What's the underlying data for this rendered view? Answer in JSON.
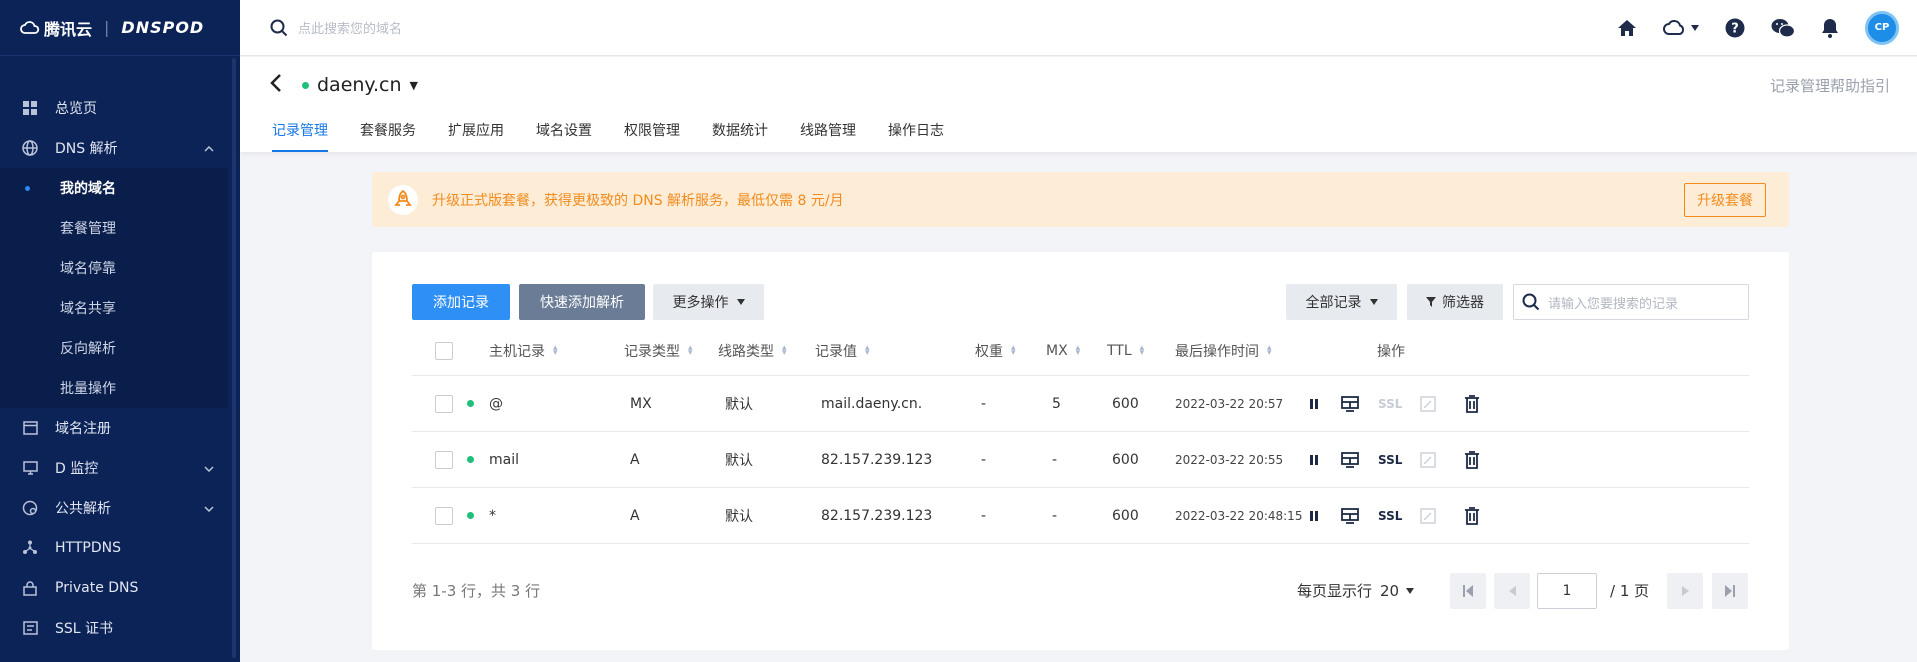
{
  "sidebar": {
    "brand": "腾讯云",
    "brand_sub": "DNSPOD",
    "items": [
      {
        "label": "总览页",
        "icon": "grid-icon"
      },
      {
        "label": "DNS 解析",
        "icon": "globe-icon",
        "expanded": true
      },
      {
        "label": "域名注册",
        "icon": "browser-icon"
      },
      {
        "label": "D 监控",
        "icon": "monitor-icon"
      },
      {
        "label": "公共解析",
        "icon": "network-icon"
      },
      {
        "label": "HTTPDNS",
        "icon": "nodes-icon"
      },
      {
        "label": "Private DNS",
        "icon": "lock-icon"
      },
      {
        "label": "SSL 证书",
        "icon": "certificate-icon"
      }
    ],
    "dns_sub": [
      "我的域名",
      "套餐管理",
      "域名停靠",
      "域名共享",
      "反向解析",
      "批量操作"
    ],
    "active_sub": "我的域名"
  },
  "topbar": {
    "search_placeholder": "点此搜索您的域名"
  },
  "header": {
    "domain": "daeny.cn",
    "domain_status_color": "#1ec07a",
    "help_link": "记录管理帮助指引",
    "tabs": [
      "记录管理",
      "套餐服务",
      "扩展应用",
      "域名设置",
      "权限管理",
      "数据统计",
      "线路管理",
      "操作日志"
    ],
    "active_tab": "记录管理"
  },
  "banner": {
    "text": "升级正式版套餐，获得更极致的 DNS 解析服务，最低仅需 8 元/月",
    "button": "升级套餐"
  },
  "toolbar": {
    "add_record": "添加记录",
    "quick_add": "快速添加解析",
    "more_ops": "更多操作",
    "all_records": "全部记录",
    "filter": "筛选器",
    "search_placeholder": "请输入您要搜索的记录"
  },
  "table": {
    "headers": {
      "host": "主机记录",
      "type": "记录类型",
      "line": "线路类型",
      "value": "记录值",
      "weight": "权重",
      "mx": "MX",
      "ttl": "TTL",
      "time": "最后操作时间",
      "ops": "操作"
    },
    "rows": [
      {
        "host": "@",
        "type": "MX",
        "line": "默认",
        "value": "mail.daeny.cn.",
        "weight": "-",
        "mx": "5",
        "ttl": "600",
        "time": "2022-03-22 20:57",
        "ssl": "SSL",
        "ssl_enabled": false
      },
      {
        "host": "mail",
        "type": "A",
        "line": "默认",
        "value": "82.157.239.123",
        "weight": "-",
        "mx": "-",
        "ttl": "600",
        "time": "2022-03-22 20:55",
        "ssl": "SSL",
        "ssl_enabled": true
      },
      {
        "host": "*",
        "type": "A",
        "line": "默认",
        "value": "82.157.239.123",
        "weight": "-",
        "mx": "-",
        "ttl": "600",
        "time": "2022-03-22 20:48:15",
        "ssl": "SSL",
        "ssl_enabled": true
      }
    ]
  },
  "pagination": {
    "summary": "第 1-3 行，共 3 行",
    "per_page_label": "每页显示行",
    "per_page_value": "20",
    "current_page": "1",
    "total_pages": "/ 1 页"
  }
}
